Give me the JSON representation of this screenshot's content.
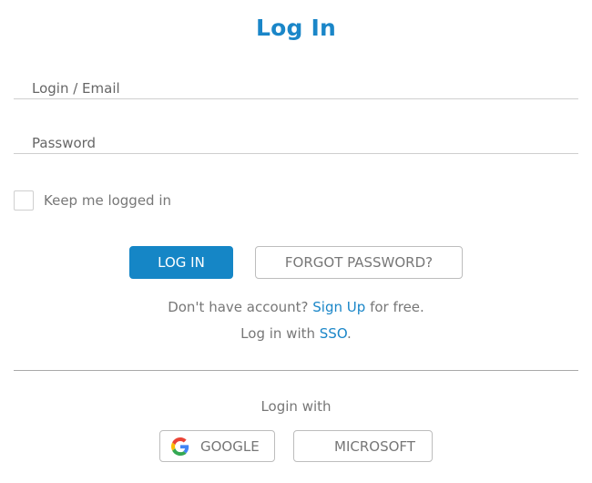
{
  "header": {
    "title": "Log In"
  },
  "form": {
    "login_label": "Login / Email",
    "password_label": "Password",
    "remember_label": "Keep me logged in",
    "remember_checked": false
  },
  "actions": {
    "login_button": "LOG IN",
    "forgot_button": "FORGOT PASSWORD?"
  },
  "signup": {
    "prefix": "Don't have account?",
    "link": "Sign Up",
    "suffix": "for free."
  },
  "sso": {
    "prefix": "Log in with",
    "link": "SSO",
    "suffix": "."
  },
  "social": {
    "heading": "Login with",
    "google_label": "GOOGLE",
    "microsoft_label": "MICROSOFT",
    "google_icon": "google-g-icon",
    "microsoft_icon": "microsoft-logo-icon"
  },
  "colors": {
    "accent": "#1586c6",
    "text": "#777777",
    "border": "#bdbdbd",
    "google_blue": "#4285F4",
    "google_red": "#EA4335",
    "google_yellow": "#FBBC05",
    "google_green": "#34A853",
    "ms_red": "#F25022",
    "ms_green": "#7FBA00",
    "ms_blue": "#00A4EF",
    "ms_yellow": "#FFB900"
  }
}
